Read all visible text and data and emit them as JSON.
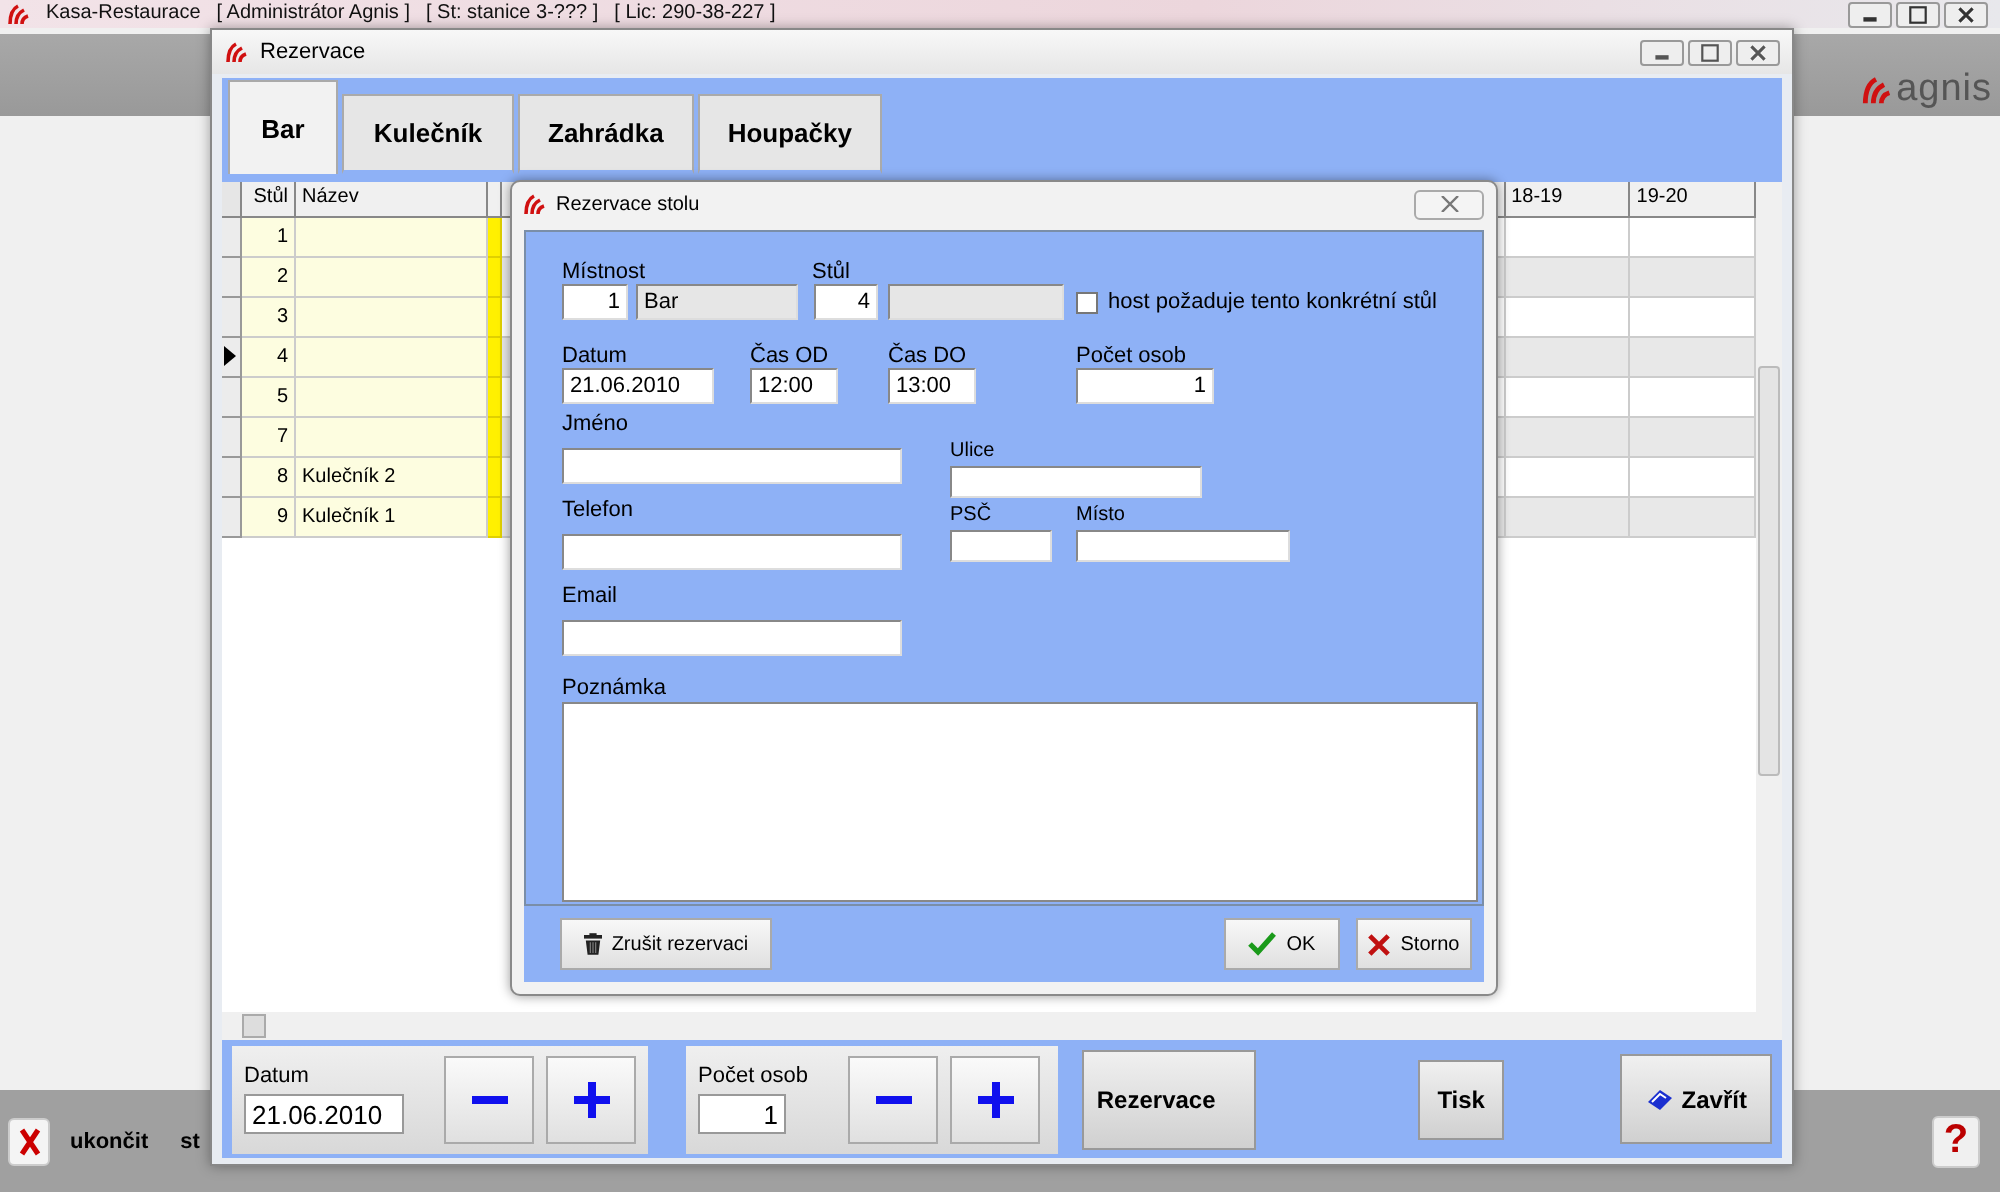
{
  "app": {
    "title": "Kasa-Restaurace",
    "user": "[ Administrátor Agnis ]",
    "station": "[ St: stanice 3-??? ]",
    "license": "[ Lic: 290-38-227 ]",
    "logo_text": "agnis",
    "exit_label": "ukončit",
    "cut_label": "st",
    "help": "?"
  },
  "window": {
    "title": "Rezervace",
    "tabs": [
      {
        "label": "Bar",
        "selected": true
      },
      {
        "label": "Kulečník",
        "selected": false
      },
      {
        "label": "Zahrádka",
        "selected": false
      },
      {
        "label": "Houpačky",
        "selected": false
      }
    ],
    "grid": {
      "columns": [
        "Stůl",
        "Název"
      ],
      "time_columns": [
        "18-19",
        "19-20"
      ],
      "rows": [
        {
          "table": "1",
          "selected": false
        },
        {
          "table": "2",
          "selected": false
        },
        {
          "table": "3",
          "selected": false
        },
        {
          "table": "4",
          "selected": true
        },
        {
          "table": "5",
          "selected": false
        },
        {
          "table": "7",
          "selected": false
        },
        {
          "table": "8",
          "name": "Kulečník 2",
          "selected": false
        },
        {
          "table": "9",
          "name": "Kulečník 1",
          "selected": false
        }
      ]
    },
    "bottom": {
      "date_label": "Datum",
      "date": "21.06.2010",
      "persons_label": "Počet osob",
      "persons": "1",
      "reserve_button": "Rezervace",
      "print_button": "Tisk",
      "close_button": "Zavřít"
    }
  },
  "dialog": {
    "title": "Rezervace stolu",
    "room_label": "Místnost",
    "room_number": "1",
    "room_name": "Bar",
    "table_label": "Stůl",
    "table_number": "4",
    "specific_table": {
      "label": "host požaduje tento konkrétní stůl",
      "checked": false
    },
    "date_label": "Datum",
    "date": "21.06.2010",
    "time_from_label": "Čas OD",
    "time_from": "12:00",
    "time_to_label": "Čas DO",
    "time_to": "13:00",
    "persons_label": "Počet osob",
    "persons": "1",
    "name_label": "Jméno",
    "phone_label": "Telefon",
    "email_label": "Email",
    "street_label": "Ulice",
    "zip_label": "PSČ",
    "city_label": "Místo",
    "note_label": "Poznámka",
    "cancel_reservation_button": "Zrušit rezervaci",
    "ok_button": "OK",
    "cancel_button": "Storno"
  }
}
